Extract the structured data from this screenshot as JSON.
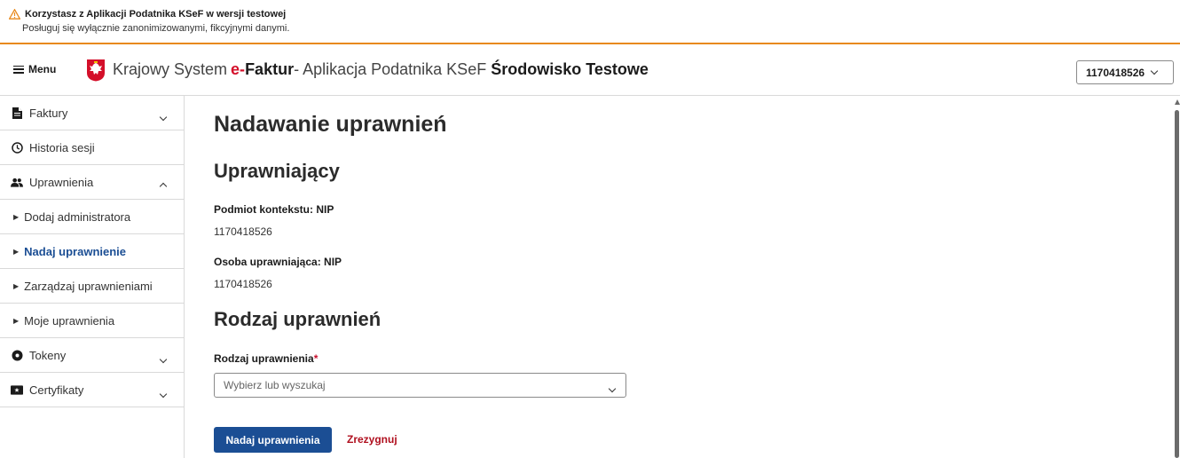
{
  "banner": {
    "title": "Korzystasz z Aplikacji Podatnika KSeF w wersji testowej",
    "subtitle": "Posługuj się wyłącznie zanonimizowanymi, fikcyjnymi danymi."
  },
  "header": {
    "menu_label": "Menu",
    "title_system": "Krajowy System",
    "title_e": "e-",
    "title_faktur": "Faktur",
    "title_rest": " - Aplikacja Podatnika KSeF",
    "title_env": "Środowisko Testowe",
    "nip_selected": "1170418526"
  },
  "sidebar": {
    "items": [
      {
        "label": "Faktury",
        "icon": "document-icon"
      },
      {
        "label": "Historia sesji",
        "icon": "clock-icon"
      },
      {
        "label": "Uprawnienia",
        "icon": "people-icon"
      },
      {
        "label": "Dodaj administratora"
      },
      {
        "label": "Nadaj uprawnienie"
      },
      {
        "label": "Zarządzaj uprawnieniami"
      },
      {
        "label": "Moje uprawnienia"
      },
      {
        "label": "Tokeny",
        "icon": "token-icon"
      },
      {
        "label": "Certyfikaty",
        "icon": "certificate-icon"
      }
    ]
  },
  "main": {
    "page_title": "Nadawanie uprawnień",
    "grantor_heading": "Uprawniający",
    "context_label": "Podmiot kontekstu: NIP",
    "context_value": "1170418526",
    "person_label": "Osoba uprawniająca: NIP",
    "person_value": "1170418526",
    "type_heading": "Rodzaj uprawnień",
    "type_field_label": "Rodzaj uprawnienia",
    "required_mark": "*",
    "type_placeholder": "Wybierz lub wyszukaj",
    "submit_label": "Nadaj uprawnienia",
    "cancel_label": "Zrezygnuj"
  },
  "colors": {
    "accent": "#1b4e94",
    "warning_border": "#e8891c",
    "danger": "#b0101f",
    "brand_red": "#d40f2a"
  }
}
